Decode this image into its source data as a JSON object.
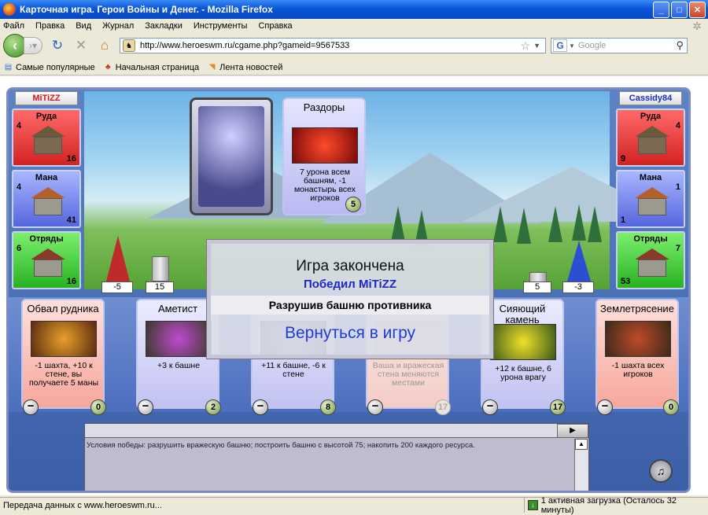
{
  "window": {
    "title": "Карточная игра. Герои Войны и Денег. - Mozilla Firefox"
  },
  "menu": [
    "Файл",
    "Правка",
    "Вид",
    "Журнал",
    "Закладки",
    "Инструменты",
    "Справка"
  ],
  "url": "http://www.heroeswm.ru/cgame.php?gameid=9567533",
  "search": {
    "engine": "G",
    "placeholder": "Google"
  },
  "bookmarks": [
    "Самые популярные",
    "Начальная страница",
    "Лента новостей"
  ],
  "players": {
    "left": {
      "name": "MiTiZZ",
      "ore": {
        "label": "Руда",
        "production": "4",
        "amount": "16"
      },
      "mana": {
        "label": "Мана",
        "production": "4",
        "amount": "41"
      },
      "troops": {
        "label": "Отряды",
        "production": "6",
        "amount": "16"
      },
      "tower": "-5",
      "wall": "15"
    },
    "right": {
      "name": "Cassidy84",
      "ore": {
        "label": "Руда",
        "production": "4",
        "amount": "9"
      },
      "mana": {
        "label": "Мана",
        "production": "1",
        "amount": "1"
      },
      "troops": {
        "label": "Отряды",
        "production": "7",
        "amount": "53"
      },
      "tower": "-3",
      "wall": "5"
    }
  },
  "played_card": {
    "title": "Раздоры",
    "desc": "7 урона всем башням, -1 монастырь всех игроков",
    "cost": "5"
  },
  "hand": [
    {
      "title": "Обвал рудника",
      "desc": "-1 шахта, +10 к стене, вы получаете 5 маны",
      "cost": "0"
    },
    {
      "title": "Аметист",
      "desc": "+3 к башне",
      "cost": "2"
    },
    {
      "title": "",
      "desc": "+11 к башне, -6 к стене",
      "cost": "8"
    },
    {
      "title": "",
      "desc": "Ваша и вражеская стена меняются местами",
      "cost": "17"
    },
    {
      "title": "Сияющий камень",
      "desc": "+12 к башне, 6 урона врагу",
      "cost": "17"
    },
    {
      "title": "Землетрясение",
      "desc": "-1 шахта всех игроков",
      "cost": "0"
    }
  ],
  "dialog": {
    "title": "Игра закончена",
    "winner": "Победил MiTiZZ",
    "reason": "Разрушив башню противника",
    "return_label": "Вернуться в игру"
  },
  "log": {
    "text": "Условия победы: разрушить вражескую башню; построить башню с высотой 75; накопить 200 каждого ресурса."
  },
  "status": {
    "left": "Передача данных с www.heroeswm.ru...",
    "right": "1 активная загрузка (Осталось 32 минуты)"
  },
  "colors": {
    "accent": "#0a55d8",
    "winner": "#1f26c7",
    "return": "#1f3cd9"
  }
}
